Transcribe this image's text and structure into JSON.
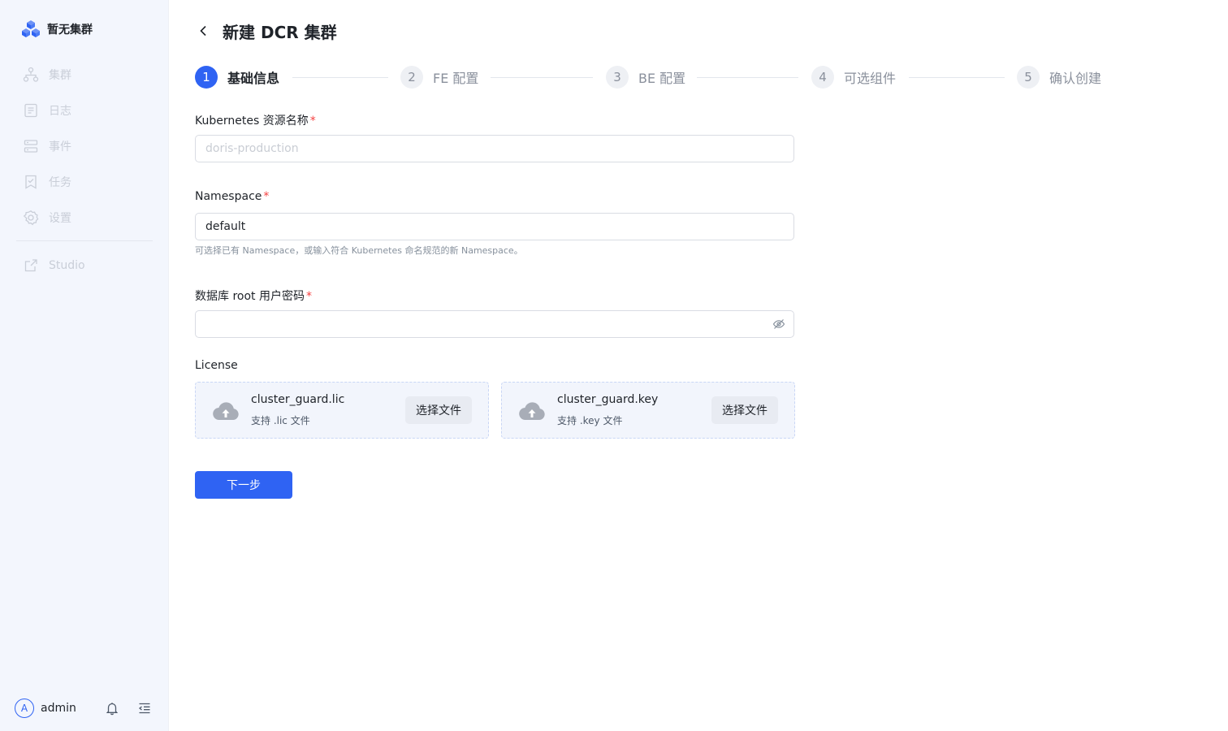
{
  "sidebar": {
    "brand": "暂无集群",
    "items": [
      {
        "label": "集群",
        "icon": "cluster-icon"
      },
      {
        "label": "日志",
        "icon": "log-icon"
      },
      {
        "label": "事件",
        "icon": "event-icon"
      },
      {
        "label": "任务",
        "icon": "task-icon"
      },
      {
        "label": "设置",
        "icon": "settings-icon"
      }
    ],
    "extra_item": {
      "label": "Studio",
      "icon": "external-link-icon"
    },
    "user": {
      "avatar_letter": "A",
      "name": "admin"
    }
  },
  "header": {
    "title": "新建 DCR 集群"
  },
  "steps": [
    {
      "number": "1",
      "label": "基础信息",
      "active": true
    },
    {
      "number": "2",
      "label": "FE 配置",
      "active": false
    },
    {
      "number": "3",
      "label": "BE 配置",
      "active": false
    },
    {
      "number": "4",
      "label": "可选组件",
      "active": false
    },
    {
      "number": "5",
      "label": "确认创建",
      "active": false
    }
  ],
  "form": {
    "resource_name": {
      "label": "Kubernetes 资源名称",
      "required_mark": "*",
      "placeholder": "doris-production",
      "value": ""
    },
    "namespace": {
      "label": "Namespace",
      "required_mark": "*",
      "value": "default",
      "help": "可选择已有 Namespace，或输入符合 Kubernetes 命名规范的新 Namespace。"
    },
    "password": {
      "label": "数据库 root 用户密码",
      "required_mark": "*",
      "value": ""
    },
    "license": {
      "label": "License",
      "files": [
        {
          "name": "cluster_guard.lic",
          "hint": "支持 .lic 文件",
          "button": "选择文件"
        },
        {
          "name": "cluster_guard.key",
          "hint": "支持 .key 文件",
          "button": "选择文件"
        }
      ]
    },
    "next_button": "下一步"
  },
  "colors": {
    "primary": "#2f63f3",
    "sidebar_bg": "#f3f6fd",
    "required": "#f53f3f"
  }
}
